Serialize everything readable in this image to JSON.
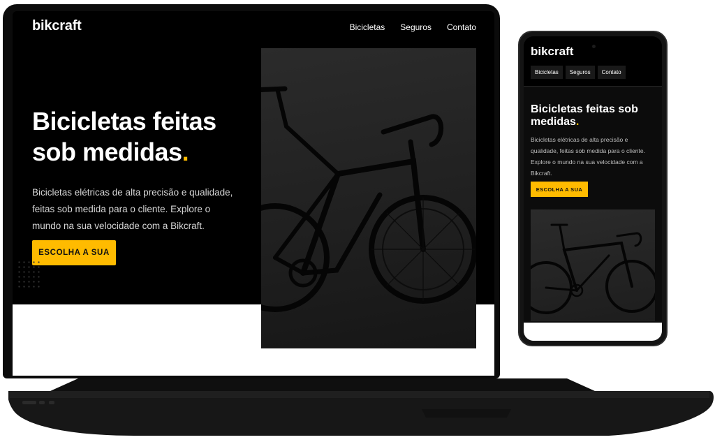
{
  "site": {
    "logo": "bikcraft",
    "nav": [
      "Bicicletas",
      "Seguros",
      "Contato"
    ],
    "hero_title": "Bicicletas feitas sob medidas",
    "hero_title_accent": ".",
    "hero_text": "Bicicletas elétricas de alta precisão e qualidade, feitas sob medida para o cliente. Explore o mundo na sua velocidade com a Bikcraft.",
    "cta": "ESCOLHA A SUA"
  },
  "colors": {
    "accent": "#ffbb00",
    "background": "#000000",
    "text": "#ffffff"
  },
  "icons": {
    "photo": "bicycle-photo",
    "dots": "dot-grid-decoration"
  }
}
